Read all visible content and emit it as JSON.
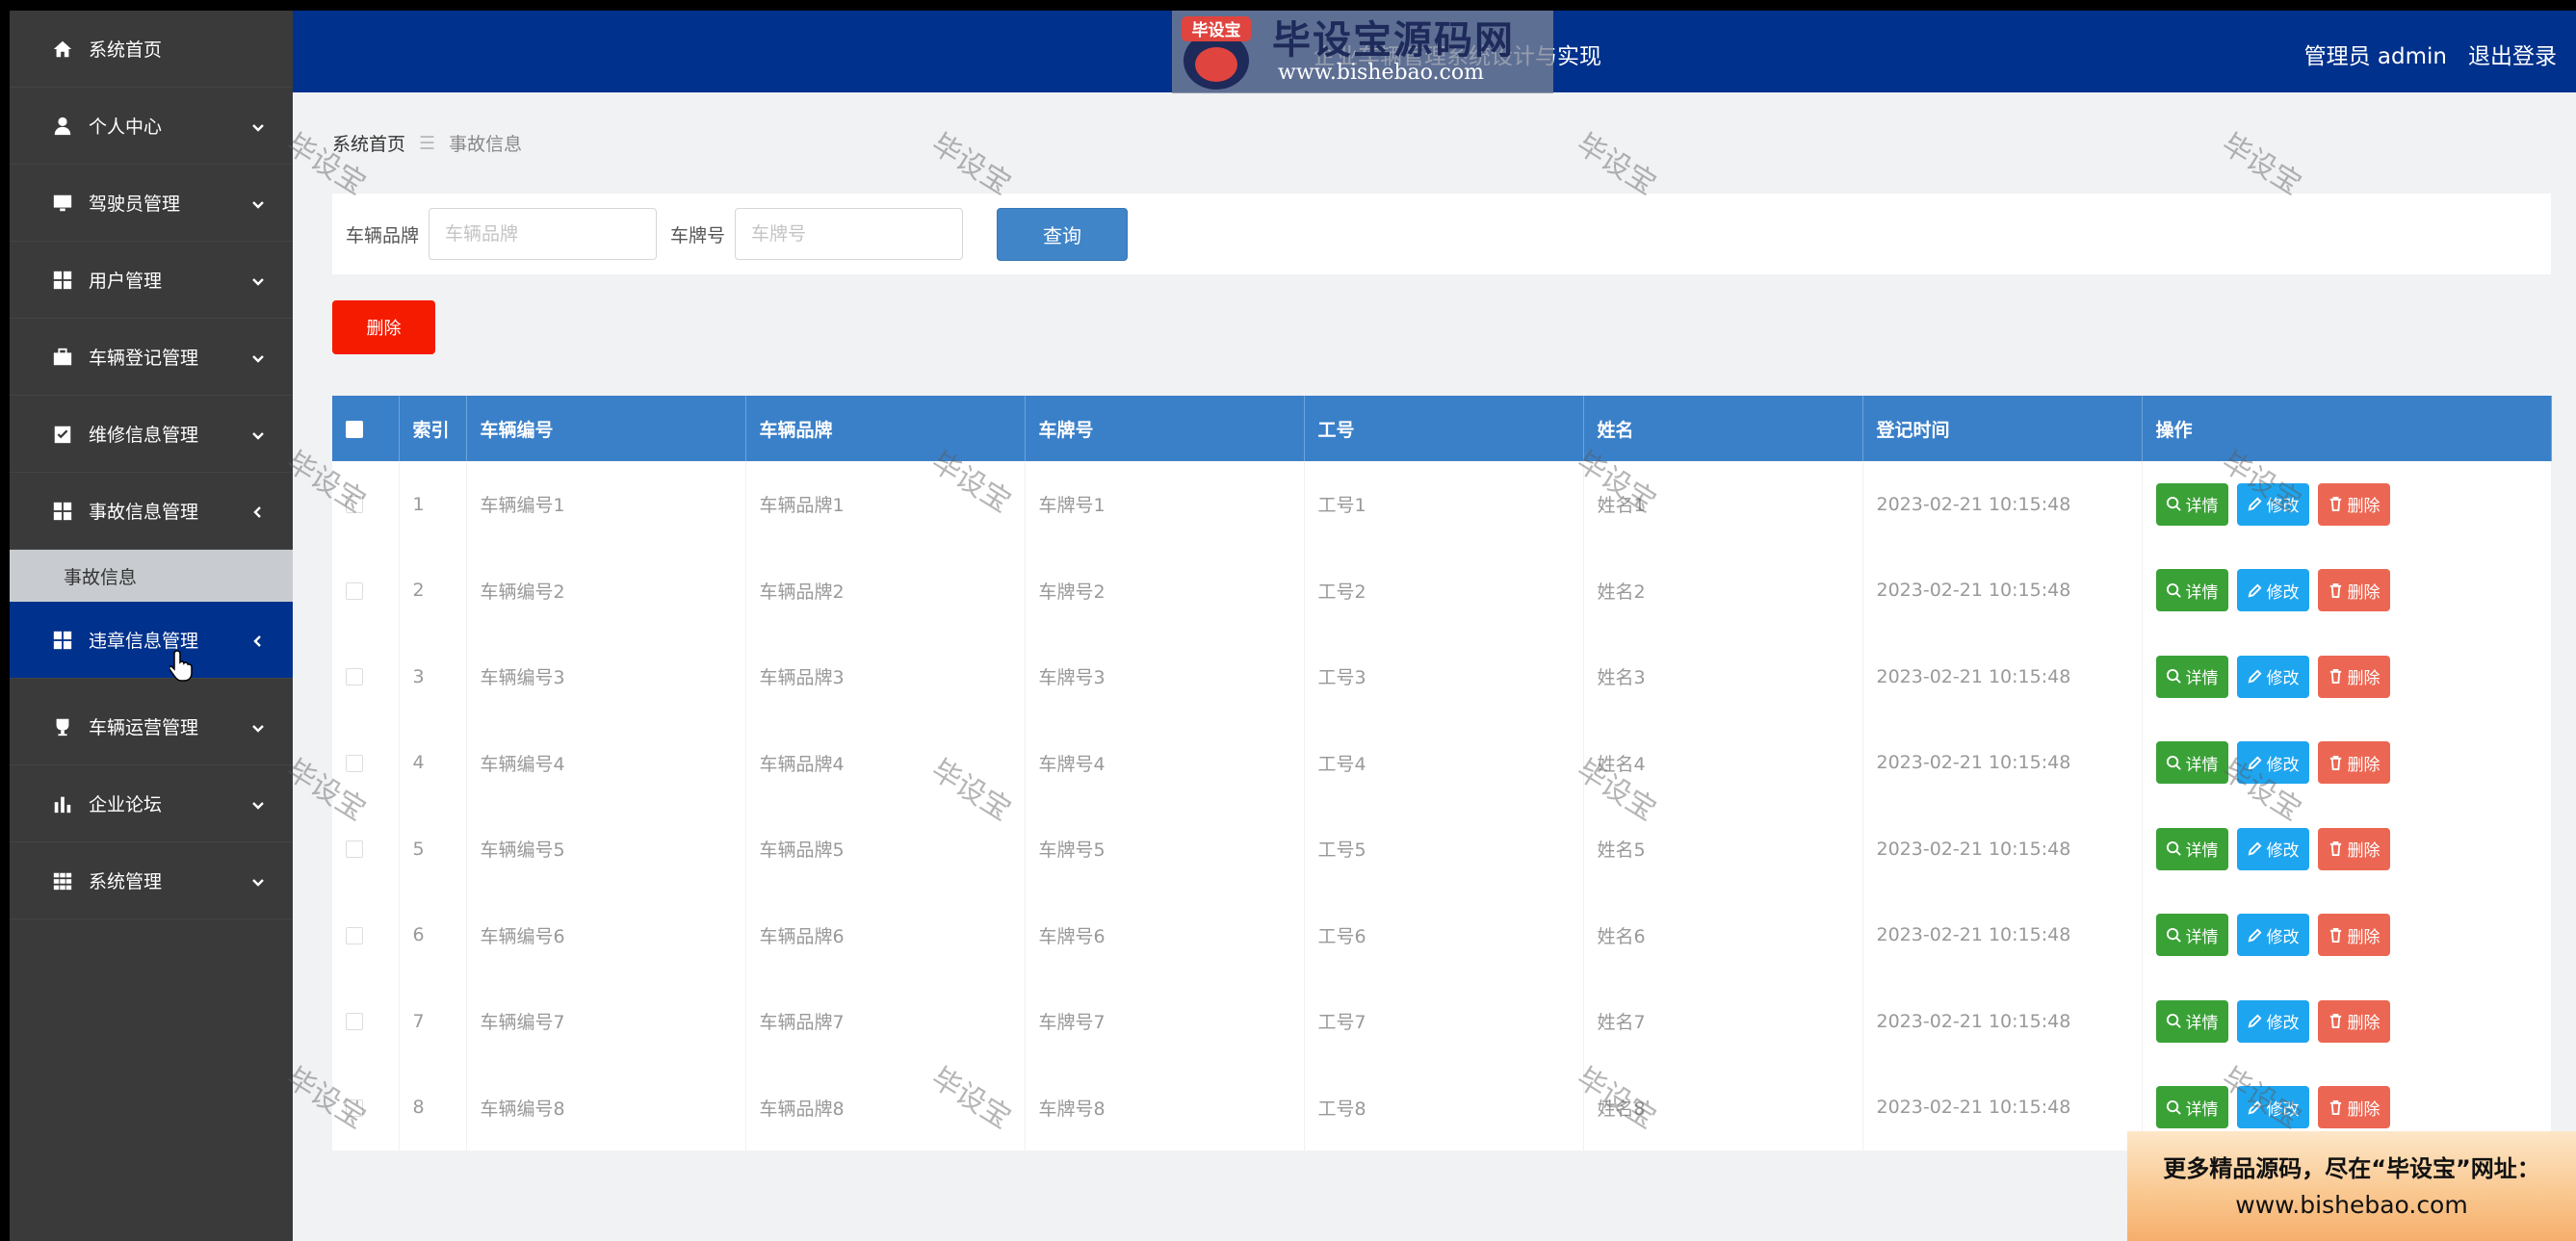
{
  "sidebar": {
    "items": [
      {
        "label": "系统首页",
        "icon": "home-icon",
        "expand": ""
      },
      {
        "label": "个人中心",
        "icon": "user-icon",
        "expand": "down"
      },
      {
        "label": "驾驶员管理",
        "icon": "monitor-icon",
        "expand": "down"
      },
      {
        "label": "用户管理",
        "icon": "grid-icon",
        "expand": "down"
      },
      {
        "label": "车辆登记管理",
        "icon": "briefcase-icon",
        "expand": "down"
      },
      {
        "label": "维修信息管理",
        "icon": "clipboard-icon",
        "expand": "down"
      },
      {
        "label": "事故信息管理",
        "icon": "grid-icon",
        "expand": "left"
      }
    ],
    "sub_item": "事故信息",
    "active_item": {
      "label": "违章信息管理",
      "icon": "grid-icon"
    },
    "items_after": [
      {
        "label": "车辆运营管理",
        "icon": "trophy-icon"
      },
      {
        "label": "企业论坛",
        "icon": "bar-chart-icon"
      },
      {
        "label": "系统管理",
        "icon": "table-icon"
      }
    ]
  },
  "header": {
    "title": "企业车辆管理系统设计与实现",
    "user_label": "管理员 admin",
    "logout": "退出登录"
  },
  "logo": {
    "badge": "毕设宝",
    "main": "毕设宝源码网",
    "url": "www.bishebao.com"
  },
  "breadcrumb": {
    "home": "系统首页",
    "sep": "☰",
    "current": "事故信息"
  },
  "search": {
    "brand_label": "车辆品牌",
    "brand_placeholder": "车辆品牌",
    "plate_label": "车牌号",
    "plate_placeholder": "车牌号",
    "query_button": "查询"
  },
  "delete_button": "删除",
  "table": {
    "headers": [
      "索引",
      "车辆编号",
      "车辆品牌",
      "车牌号",
      "工号",
      "姓名",
      "登记时间",
      "操作"
    ],
    "rows": [
      {
        "index": "1",
        "vehicle_no": "车辆编号1",
        "brand": "车辆品牌1",
        "plate": "车牌号1",
        "work_no": "工号1",
        "name": "姓名1",
        "time": "2023-02-21 10:15:48"
      },
      {
        "index": "2",
        "vehicle_no": "车辆编号2",
        "brand": "车辆品牌2",
        "plate": "车牌号2",
        "work_no": "工号2",
        "name": "姓名2",
        "time": "2023-02-21 10:15:48"
      },
      {
        "index": "3",
        "vehicle_no": "车辆编号3",
        "brand": "车辆品牌3",
        "plate": "车牌号3",
        "work_no": "工号3",
        "name": "姓名3",
        "time": "2023-02-21 10:15:48"
      },
      {
        "index": "4",
        "vehicle_no": "车辆编号4",
        "brand": "车辆品牌4",
        "plate": "车牌号4",
        "work_no": "工号4",
        "name": "姓名4",
        "time": "2023-02-21 10:15:48"
      },
      {
        "index": "5",
        "vehicle_no": "车辆编号5",
        "brand": "车辆品牌5",
        "plate": "车牌号5",
        "work_no": "工号5",
        "name": "姓名5",
        "time": "2023-02-21 10:15:48"
      },
      {
        "index": "6",
        "vehicle_no": "车辆编号6",
        "brand": "车辆品牌6",
        "plate": "车牌号6",
        "work_no": "工号6",
        "name": "姓名6",
        "time": "2023-02-21 10:15:48"
      },
      {
        "index": "7",
        "vehicle_no": "车辆编号7",
        "brand": "车辆品牌7",
        "plate": "车牌号7",
        "work_no": "工号7",
        "name": "姓名7",
        "time": "2023-02-21 10:15:48"
      },
      {
        "index": "8",
        "vehicle_no": "车辆编号8",
        "brand": "车辆品牌8",
        "plate": "车牌号8",
        "work_no": "工号8",
        "name": "姓名8",
        "time": "2023-02-21 10:15:48"
      }
    ],
    "action_detail": "详情",
    "action_edit": "修改",
    "action_delete": "删除"
  },
  "watermark": "毕设宝",
  "promo": {
    "line1": "更多精品源码，尽在“毕设宝”网址：",
    "line2": "www.bishebao.com"
  },
  "colors": {
    "header_bg": "#00318c",
    "sidebar_bg": "#3a3a3a",
    "table_header": "#3a80c9",
    "detail_btn": "#3aa136",
    "edit_btn": "#1ea5f0",
    "delete_btn": "#ec6753",
    "main_delete": "#f51b00"
  }
}
